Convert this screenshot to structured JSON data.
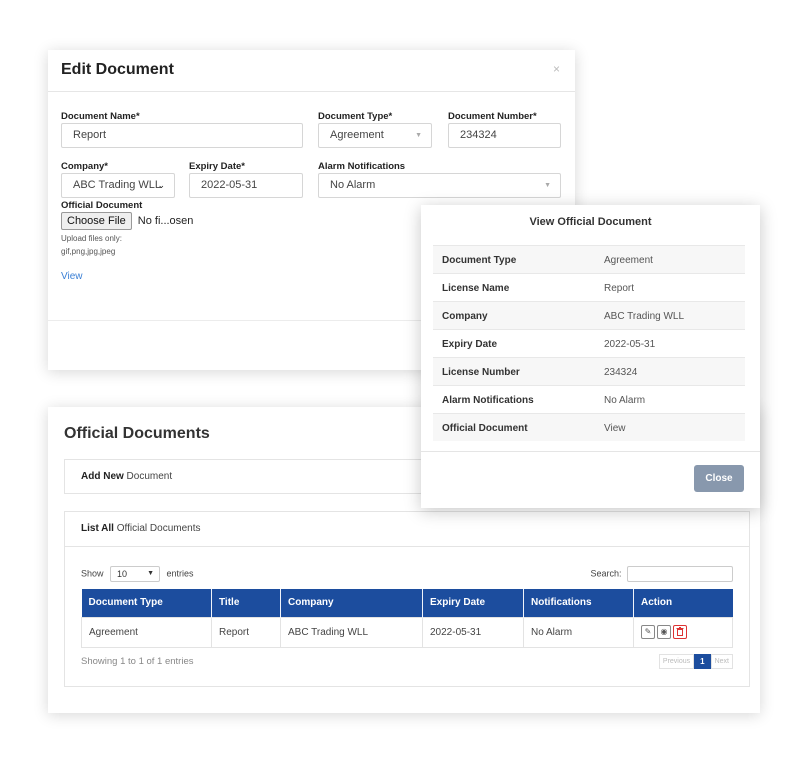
{
  "edit_modal": {
    "title": "Edit Document",
    "close_glyph": "×",
    "document_name_label": "Document Name*",
    "document_name_value": "Report",
    "document_type_label": "Document Type*",
    "document_type_value": "Agreement",
    "document_number_label": "Document Number*",
    "document_number_value": "234324",
    "company_label": "Company*",
    "company_value": "ABC Trading WLL",
    "expiry_date_label": "Expiry Date*",
    "expiry_date_value": "2022-05-31",
    "alarm_label": "Alarm Notifications",
    "alarm_value": "No Alarm",
    "official_document_label": "Official Document",
    "choose_file_label": "Choose File",
    "no_file_text": "No fi...osen",
    "upload_hint_line1": "Upload files only:",
    "upload_hint_line2": "gif,png,jpg,jpeg",
    "view_link": "View"
  },
  "view_modal": {
    "title": "View Official Document",
    "rows": [
      {
        "key": "Document Type",
        "value": "Agreement"
      },
      {
        "key": "License Name",
        "value": "Report"
      },
      {
        "key": "Company",
        "value": "ABC Trading WLL"
      },
      {
        "key": "Expiry Date",
        "value": "2022-05-31"
      },
      {
        "key": "License Number",
        "value": "234324"
      },
      {
        "key": "Alarm Notifications",
        "value": "No Alarm"
      },
      {
        "key": "Official Document",
        "value": "View"
      }
    ],
    "close_label": "Close"
  },
  "docs_page": {
    "title": "Official Documents",
    "add_new_bold": "Add New",
    "add_new_rest": " Document",
    "list_all_bold": "List All",
    "list_all_rest": " Official Documents",
    "show_label": "Show",
    "entries_value": "10",
    "entries_label": "entries",
    "search_label": "Search:",
    "columns": [
      "Document Type",
      "Title",
      "Company",
      "Expiry Date",
      "Notifications",
      "Action"
    ],
    "rows": [
      {
        "document_type": "Agreement",
        "title": "Report",
        "company": "ABC Trading WLL",
        "expiry_date": "2022-05-31",
        "notifications": "No Alarm"
      }
    ],
    "showing_text": "Showing 1 to 1 of 1 entries",
    "pager_previous": "Previous",
    "pager_current": "1",
    "pager_next": "Next"
  },
  "icons": {
    "edit": "pencil-icon",
    "view": "eye-icon",
    "delete": "trash-icon",
    "dropdown": "chevron-down-icon"
  },
  "colors": {
    "table_header": "#1c4d9e",
    "link": "#3a7fd5",
    "close_button": "#8898ad",
    "delete_accent": "#dd3333"
  }
}
